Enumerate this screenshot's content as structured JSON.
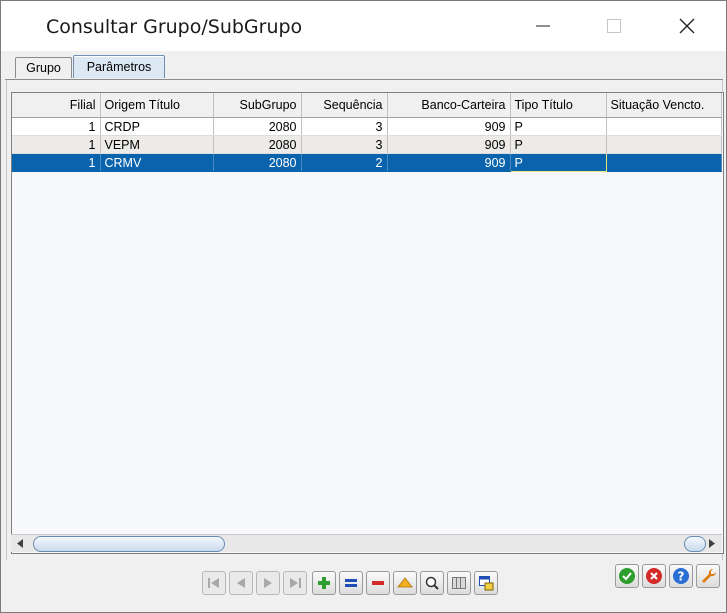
{
  "window": {
    "title": "Consultar Grupo/SubGrupo"
  },
  "tabs": [
    {
      "label": "Grupo"
    },
    {
      "label": "Parâmetros"
    }
  ],
  "grid": {
    "columns": [
      "Filial",
      "Origem Título",
      "SubGrupo",
      "Sequência",
      "Banco-Carteira",
      "Tipo Título",
      "Situação Vencto."
    ],
    "rows": [
      {
        "filial": "1",
        "origem": "CRDP",
        "subgrupo": "2080",
        "sequencia": "3",
        "banco": "909",
        "tipo": "P",
        "situacao": ""
      },
      {
        "filial": "1",
        "origem": "VEPM",
        "subgrupo": "2080",
        "sequencia": "3",
        "banco": "909",
        "tipo": "P",
        "situacao": ""
      },
      {
        "filial": "1",
        "origem": "CRMV",
        "subgrupo": "2080",
        "sequencia": "2",
        "banco": "909",
        "tipo": "P",
        "situacao": ""
      }
    ],
    "selected_row": 2
  },
  "colors": {
    "selection": "#0a64ad",
    "confirm": "#2e9e2e",
    "cancel": "#d42a2a",
    "help": "#2a6fd4",
    "tools": "#e07d10"
  }
}
